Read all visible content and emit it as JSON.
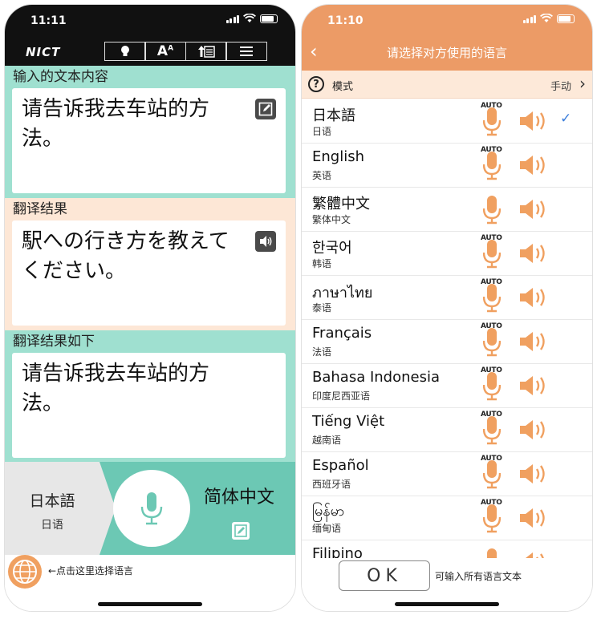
{
  "left_screen": {
    "status": {
      "time": "11:11"
    },
    "header": {
      "logo": "NICT",
      "toolbar": [
        {
          "icon": "lightbulb-icon"
        },
        {
          "icon": "font-size-icon",
          "label": "A"
        },
        {
          "icon": "upload-form-icon"
        },
        {
          "icon": "menu-icon"
        }
      ]
    },
    "input_section": {
      "label": "输入的文本内容",
      "text": "请告诉我去车站的方法。"
    },
    "result_section": {
      "label": "翻译结果",
      "text": "駅への行き方を教えてください。"
    },
    "backtranslation_section": {
      "label": "翻译结果如下",
      "text": "请告诉我去车站的方法。"
    },
    "language_bar": {
      "source_name": "日本語",
      "source_sub": "日语",
      "target_name": "简体中文"
    },
    "footer": {
      "hint": "←点击这里选择语言"
    },
    "colors": {
      "header": "#111111",
      "mint": "#9fe0d0",
      "peach": "#fde7d6",
      "teal": "#6cc8b4",
      "globe": "#f0a060"
    }
  },
  "right_screen": {
    "status": {
      "time": "11:10"
    },
    "nav": {
      "title": "请选择对方使用的语言"
    },
    "mode": {
      "label": "模式",
      "value": "手动"
    },
    "languages": [
      {
        "name": "日本語",
        "sub": "日语",
        "auto": true,
        "selected": true
      },
      {
        "name": "English",
        "sub": "英语",
        "auto": true,
        "selected": false
      },
      {
        "name": "繁體中文",
        "sub": "繁体中文",
        "auto": false,
        "selected": false
      },
      {
        "name": "한국어",
        "sub": "韩语",
        "auto": true,
        "selected": false
      },
      {
        "name": "ภาษาไทย",
        "sub": "泰语",
        "auto": true,
        "selected": false
      },
      {
        "name": "Français",
        "sub": "法语",
        "auto": true,
        "selected": false
      },
      {
        "name": "Bahasa Indonesia",
        "sub": "印度尼西亚语",
        "auto": true,
        "selected": false
      },
      {
        "name": "Tiếng Việt",
        "sub": "越南语",
        "auto": true,
        "selected": false
      },
      {
        "name": "Español",
        "sub": "西班牙语",
        "auto": true,
        "selected": false
      },
      {
        "name": "မြန်မာ",
        "sub": "缅甸语",
        "auto": true,
        "selected": false
      },
      {
        "name": "Filipino",
        "sub": "",
        "auto": false,
        "selected": false
      }
    ],
    "auto_badge": "AUTO",
    "footer": {
      "ok_label": "OK",
      "note": "可输入所有语言文本"
    },
    "colors": {
      "header": "#ec9b66",
      "mic": "#f0a060",
      "check": "#3b7ddb"
    }
  }
}
